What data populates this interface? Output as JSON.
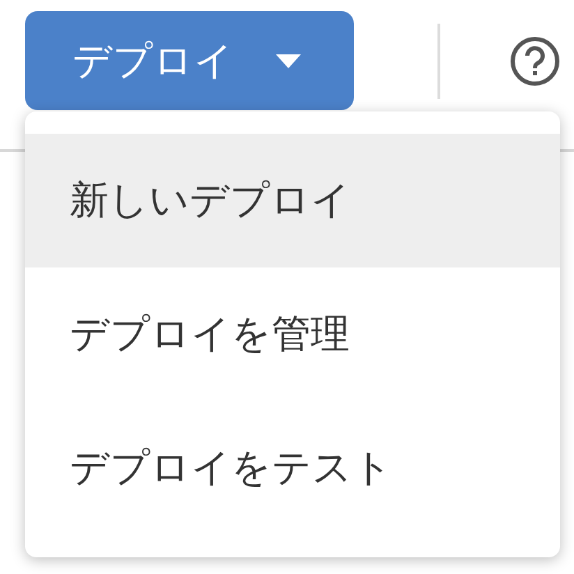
{
  "deploy_button": {
    "label": "デプロイ"
  },
  "menu": {
    "items": [
      {
        "label": "新しいデプロイ",
        "selected": true
      },
      {
        "label": "デプロイを管理",
        "selected": false
      },
      {
        "label": "デプロイをテスト",
        "selected": false
      }
    ]
  }
}
